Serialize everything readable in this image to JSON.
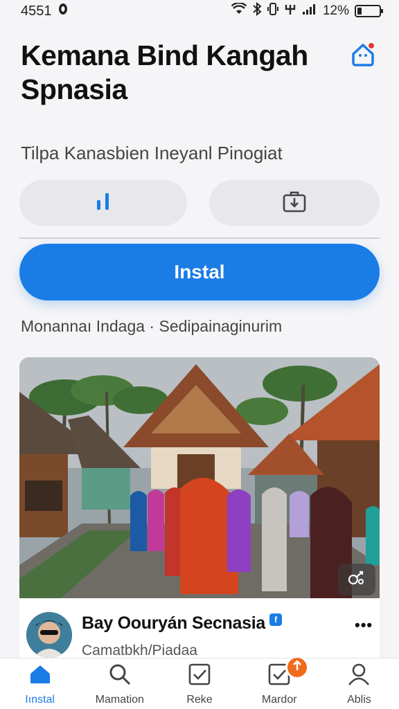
{
  "status": {
    "time": "4551",
    "battery": "12%"
  },
  "app": {
    "title": "Kemana Bind Kangah Spnasia",
    "subtitle": "Tilpa Kanasbien Ineyanl Pinogiat",
    "install_label": "Instal",
    "meta_text": "Monannaı Indaga · Sedipainaginurim"
  },
  "icons": {
    "home": "home-icon",
    "stats": "bar-chart-icon",
    "share": "share-icon",
    "favorite": "heart-link-icon",
    "verified": "verified-icon"
  },
  "card": {
    "name": "Bay Oouryán Secnasia",
    "location": "Camatbkh/Piadaa"
  },
  "nav": {
    "items": [
      {
        "label": "Iınstal",
        "icon": "home-icon",
        "active": true
      },
      {
        "label": "Mamation",
        "icon": "search-icon"
      },
      {
        "label": "Reke",
        "icon": "checkbox-icon"
      },
      {
        "label": "Mardor",
        "icon": "checkbox-icon"
      },
      {
        "label": "Ablis",
        "icon": "person-icon"
      }
    ]
  },
  "colors": {
    "accent": "#1a7de6",
    "badge": "#f06a1b",
    "notification": "#e53935"
  }
}
